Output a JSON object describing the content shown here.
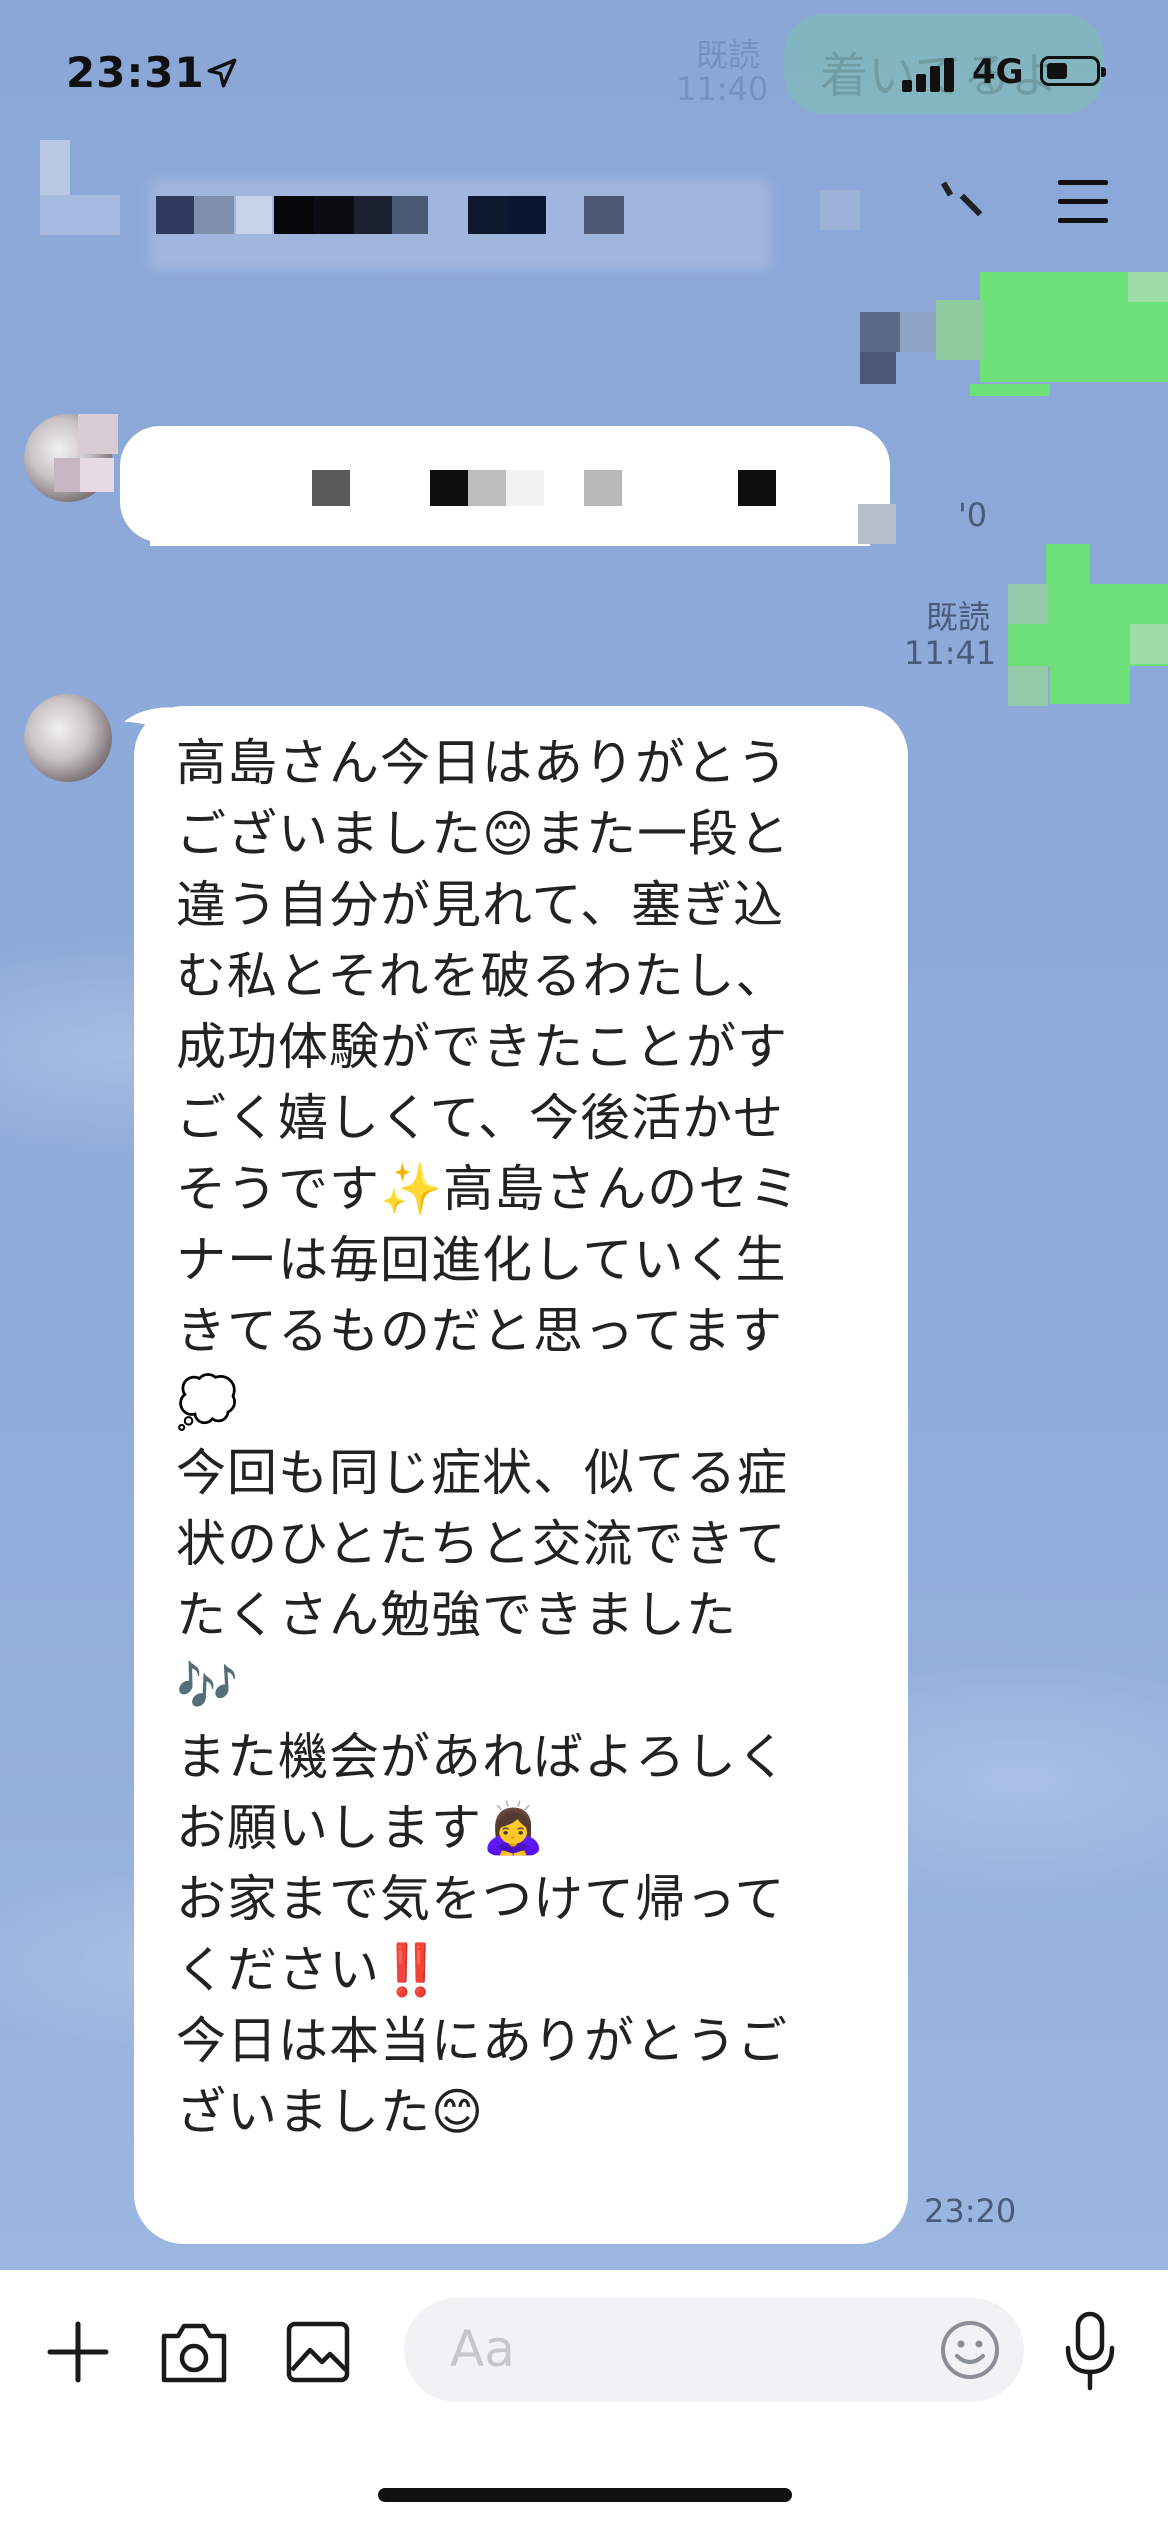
{
  "status_bar": {
    "time": "23:31",
    "network": "4G"
  },
  "header": {
    "menu_icon": "hamburger-menu-icon"
  },
  "top_background": {
    "ghost_read": "既読",
    "ghost_time": "11:40",
    "ghost_bubble_text": "着いてるよ"
  },
  "messages": [
    {
      "side": "outgoing",
      "read_label": "",
      "time": ""
    },
    {
      "side": "incoming",
      "time": "'0"
    },
    {
      "side": "outgoing",
      "read_label": "既読",
      "time": "11:41"
    },
    {
      "side": "incoming",
      "time": "23:20",
      "text": "高島さん今日はありがとう\nございました😊また一段と\n違う自分が見れて、塞ぎ込\nむ私とそれを破るわたし、\n成功体験ができたことがす\nごく嬉しくて、今後活かせ\nそうです✨高島さんのセミ\nナーは毎回進化していく生\nきてるものだと思ってます\n💭\n今回も同じ症状、似てる症\n状のひとたちと交流できて\nたくさん勉強できました\n🎶\nまた機会があればよろしく\nお願いします🙇‍♀️\nお家まで気をつけて帰って\nください‼️\n今日は本当にありがとうご\nざいました😊"
    }
  ],
  "input_bar": {
    "placeholder": "Aa",
    "icons": [
      "plus-icon",
      "camera-icon",
      "image-icon",
      "emoji-icon",
      "microphone-icon"
    ]
  },
  "colors": {
    "chat_background": "#8fabd9",
    "outgoing_bubble": "#6ee07a",
    "incoming_bubble": "#ffffff"
  }
}
